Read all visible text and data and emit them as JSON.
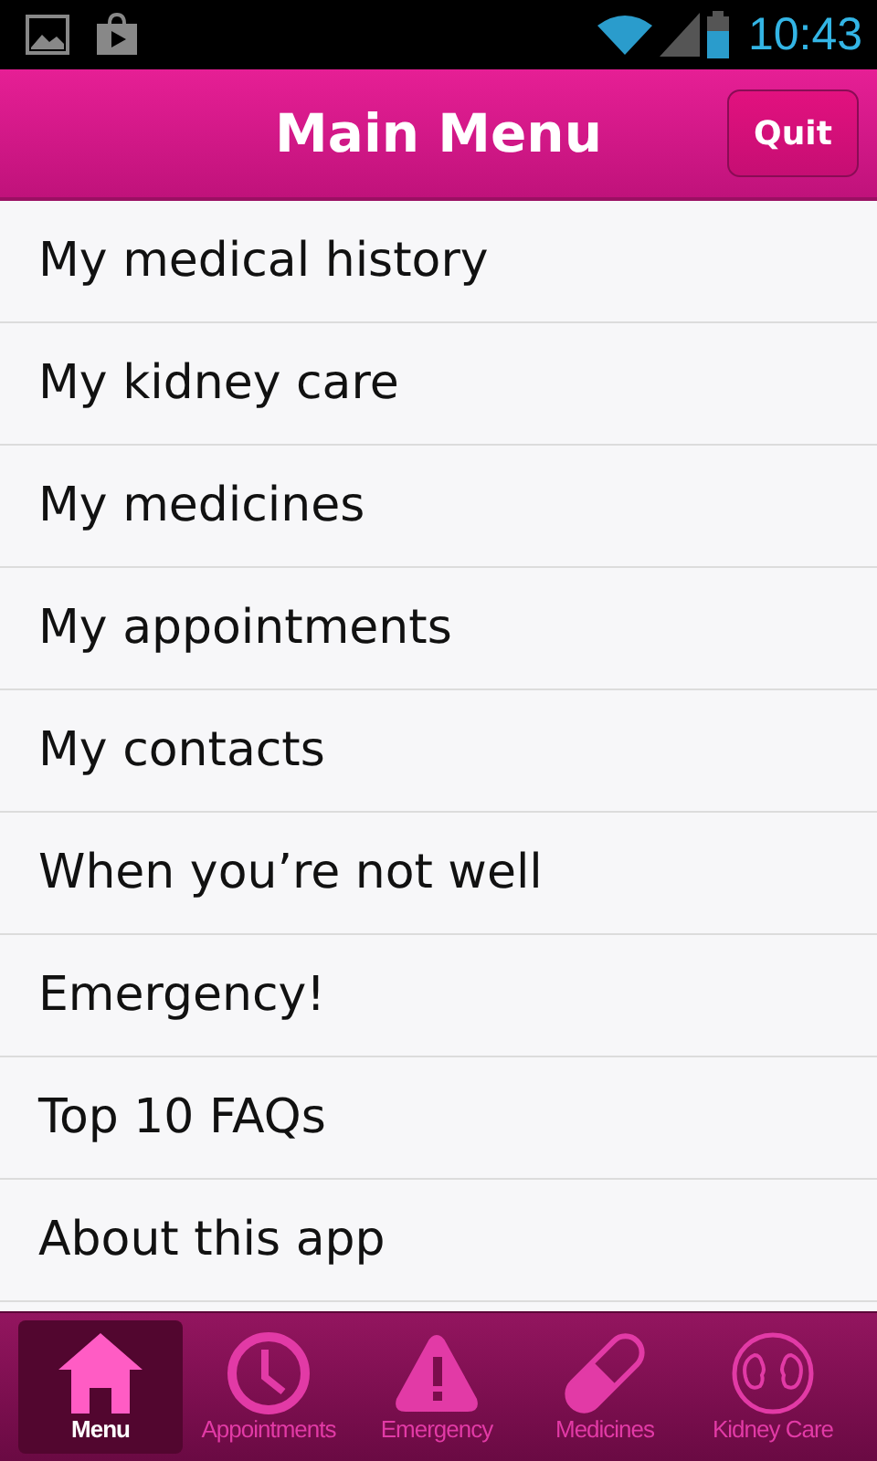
{
  "status_bar": {
    "time": "10:43"
  },
  "header": {
    "title": "Main Menu",
    "quit_button": "Quit"
  },
  "menu_items": [
    {
      "label": "My medical history"
    },
    {
      "label": "My kidney care"
    },
    {
      "label": "My medicines"
    },
    {
      "label": "My appointments"
    },
    {
      "label": "My contacts"
    },
    {
      "label": "When you’re not well"
    },
    {
      "label": "Emergency!"
    },
    {
      "label": "Top 10 FAQs"
    },
    {
      "label": "About this app"
    }
  ],
  "tab_bar": [
    {
      "label": "Menu",
      "kind": "home",
      "selected": true
    },
    {
      "label": "Appointments",
      "kind": "clock",
      "selected": false
    },
    {
      "label": "Emergency",
      "kind": "warning",
      "selected": false
    },
    {
      "label": "Medicines",
      "kind": "pill",
      "selected": false
    },
    {
      "label": "Kidney Care",
      "kind": "kidney",
      "selected": false
    }
  ]
}
